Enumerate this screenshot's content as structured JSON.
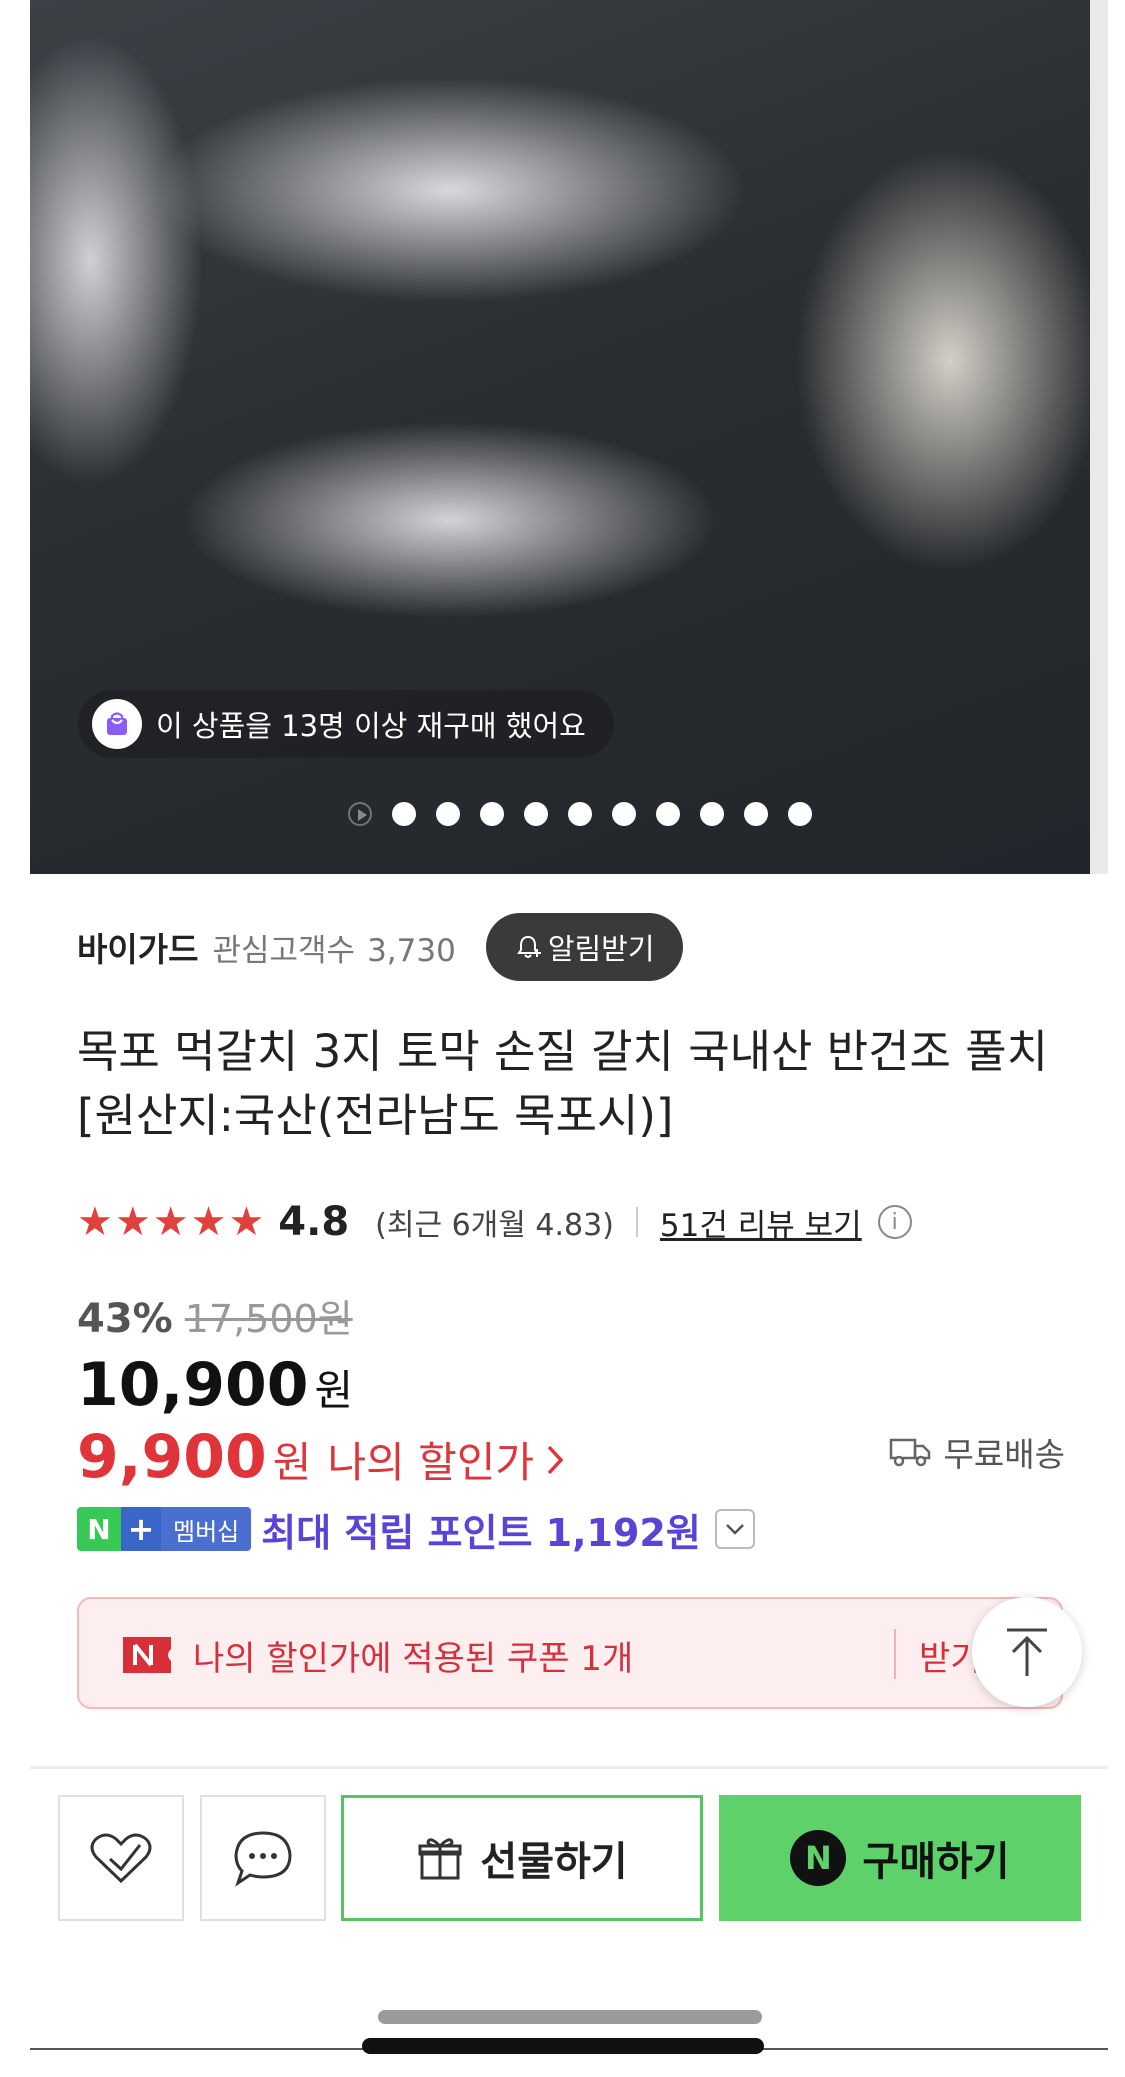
{
  "hero": {
    "repurchase_text": "이 상품을 13명 이상 재구매 했어요",
    "dot_count": 10
  },
  "store": {
    "name": "바이가드",
    "follower_label": "관심고객수",
    "follower_count": "3,730",
    "alert_label": "알림받기"
  },
  "product": {
    "title": "목포 먹갈치 3지 토막 손질 갈치 국내산 반건조 풀치 [원산지:국산(전라남도 목포시)]"
  },
  "rating": {
    "stars": "★★★★★",
    "score": "4.8",
    "recent": "(최근 6개월 4.83)",
    "review_link": "51건 리뷰 보기"
  },
  "price": {
    "discount_pct": "43%",
    "original": "17,500원",
    "sale": "10,900",
    "won": "원",
    "my_price": "9,900",
    "my_won": "원",
    "my_label": "나의 할인가",
    "shipping": "무료배송"
  },
  "points": {
    "badge_n": "N",
    "badge_plus": "+",
    "badge_member": "멤버십",
    "text": "최대 적립 포인트 1,192원"
  },
  "coupon": {
    "text": "나의 할인가에 적용된 쿠폰 1개",
    "action": "받기"
  },
  "bottom_bar": {
    "gift_label": "선물하기",
    "buy_label": "구매하기",
    "n_logo": "N"
  },
  "colors": {
    "accent_red": "#e0333a",
    "naver_green": "#5ed16a",
    "point_purple": "#5a43d6"
  }
}
